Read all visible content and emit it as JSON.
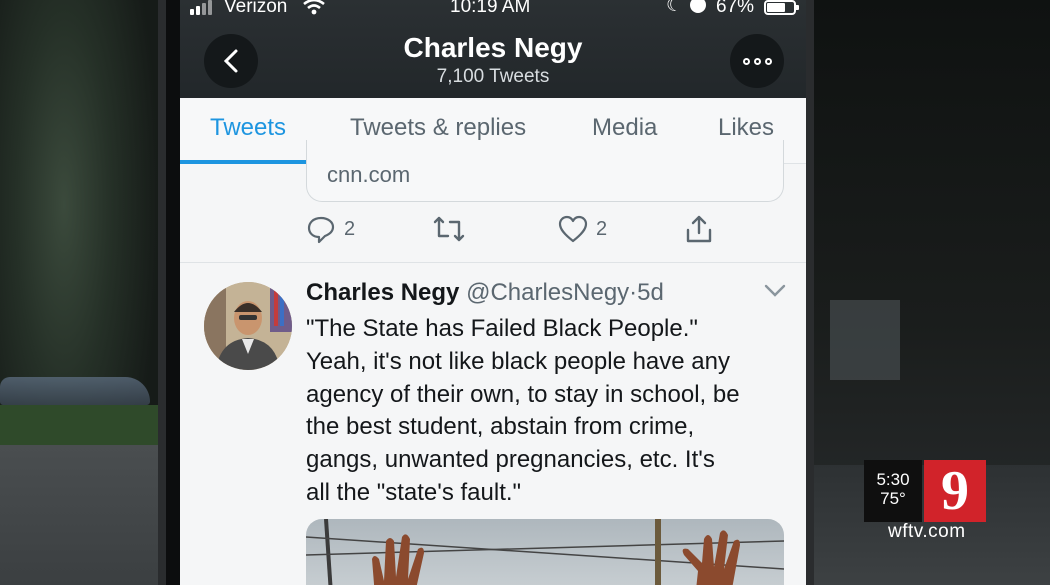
{
  "status_bar": {
    "carrier": "Verizon",
    "time": "10:19 AM",
    "battery": "67%"
  },
  "profile": {
    "name": "Charles Negy",
    "tweet_count": "7,100 Tweets"
  },
  "tabs": [
    {
      "label": "Tweets",
      "active": true
    },
    {
      "label": "Tweets & replies",
      "active": false
    },
    {
      "label": "Media",
      "active": false
    },
    {
      "label": "Likes",
      "active": false
    }
  ],
  "previous_tweet": {
    "link_domain": "cnn.com",
    "reply_count": "2",
    "like_count": "2"
  },
  "tweet": {
    "author": "Charles Negy",
    "handle": "@CharlesNegy",
    "separator": "·",
    "age": "5d",
    "lines": [
      "\"The State has Failed Black People.\"",
      "Yeah, it's not like black people have any",
      "agency of their own, to stay in school, be",
      "the best student, abstain from crime,",
      "gangs, unwanted pregnancies, etc.  It's",
      "all the \"state's fault.\""
    ]
  },
  "tv_overlay": {
    "time": "5:30",
    "temperature": "75°",
    "channel": "9",
    "website": "wftv.com"
  },
  "colors": {
    "twitter_blue": "#1d95e0",
    "wftv_red": "#d1232a",
    "header_dark": "#2b3033"
  },
  "icons": [
    "back-arrow-icon",
    "more-icon",
    "reply-icon",
    "retweet-icon",
    "like-icon",
    "share-icon",
    "chevron-down-icon",
    "wifi-icon",
    "signal-icon",
    "moon-icon",
    "alarm-icon",
    "battery-icon"
  ]
}
